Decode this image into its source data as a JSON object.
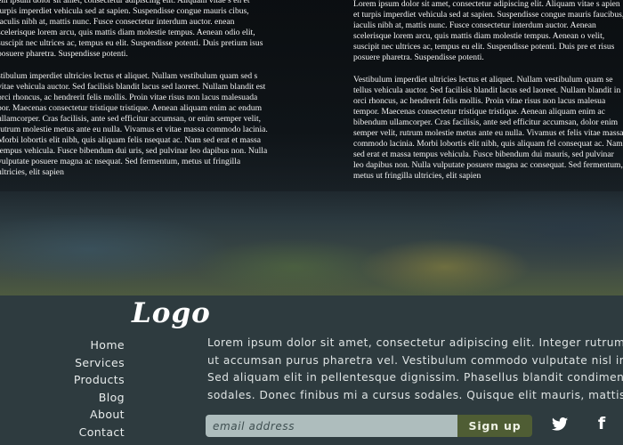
{
  "hero": {
    "left_column": [
      "em ipsum dolor sit amet, consectetur adipiscing elit. Aliquam vitae s en et turpis imperdiet vehicula sed at sapien. Suspendisse congue mauris cibus, iaculis nibh at, mattis nunc. Fusce consectetur interdum auctor. enean scelerisque lorem arcu, quis mattis diam molestie tempus. Aenean odio elit, suscipit nec ultrices ac, tempus eu elit. Suspendisse potenti. Duis pretium isus posuere pharetra. Suspendisse potenti.",
      "stibulum imperdiet ultricies lectus et aliquet. Nullam vestibulum quam sed s vitae vehicula auctor. Sed facilisis blandit lacus sed laoreet. Nullam blandit est orci rhoncus, ac hendrerit felis mollis. Proin vitae risus non lacus malesuada por. Maecenas consectetur tristique tristique. Aenean aliquam enim ac endum ullamcorper. Cras facilisis, ante sed efficitur accumsan, or enim semper velit, rutrum molestie metus ante eu nulla. Vivamus et vitae massa commodo lacinia. Morbi lobortis elit nibh, quis aliquam felis nsequat ac. Nam sed erat et massa tempus vehicula. Fusce bibendum dui uris, sed pulvinar leo dapibus non. Nulla vulputate posuere magna ac nsequat. Sed fermentum, metus ut fringilla ultricies, elit sapien"
    ],
    "right_column": [
      "Lorem ipsum dolor sit amet, consectetur adipiscing elit. Aliquam vitae s apien et turpis imperdiet vehicula sed at sapien. Suspendisse congue mauris faucibus, iaculis nibh at, mattis nunc. Fusce consectetur interdum auctor. Aenean scelerisque lorem arcu, quis mattis diam molestie tempus. Aenean o velit, suscipit nec ultrices ac, tempus eu elit. Suspendisse potenti. Duis pre et risus posuere pharetra. Suspendisse potenti.",
      "Vestibulum imperdiet ultricies lectus et aliquet. Nullam vestibulum quam se tellus vehicula auctor. Sed facilisis blandit lacus sed laoreet. Nullam blandit in orci rhoncus, ac hendrerit felis mollis. Proin vitae risus non lacus malesua tempor. Maecenas consectetur tristique tristique. Aenean aliquam enim ac bibendum ullamcorper. Cras facilisis, ante sed efficitur accumsan, dolor enim semper velit, rutrum molestie metus ante eu nulla. Vivamus et felis vitae massa commodo lacinia. Morbi lobortis elit nibh, quis aliquam fel consequat ac. Nam sed erat et massa tempus vehicula. Fusce bibendum dui mauris, sed pulvinar leo dapibus non. Nulla vulputate posuere magna ac consequat. Sed fermentum, metus ut fringilla ultricies, elit sapien"
    ]
  },
  "footer": {
    "logo": "Logo",
    "nav": [
      {
        "label": "Home"
      },
      {
        "label": "Services"
      },
      {
        "label": "Products"
      },
      {
        "label": "Blog"
      },
      {
        "label": "About"
      },
      {
        "label": "Contact"
      }
    ],
    "blurb_lines": [
      "Lorem ipsum dolor sit amet, consectetur adipiscing elit. Integer rutrum po",
      "ut accumsan purus pharetra vel. Vestibulum commodo vulputate nisl inter",
      " Sed aliquam elit in pellentesque dignissim. Phasellus blandit condimentu",
      "sodales. Donec finibus mi a cursus sodales. Quisque elit mauris, mattis u"
    ],
    "signup": {
      "email_placeholder": "email address",
      "email_value": "",
      "button_label": "Sign up"
    },
    "social": [
      {
        "icon": "twitter-icon"
      },
      {
        "icon": "facebook-icon",
        "glyph": "f"
      }
    ]
  },
  "colors": {
    "footer_background": "#2e3b3f",
    "input_background": "#aebdbd",
    "button_background": "#4f5d34",
    "text_light": "#f2f2f2"
  }
}
